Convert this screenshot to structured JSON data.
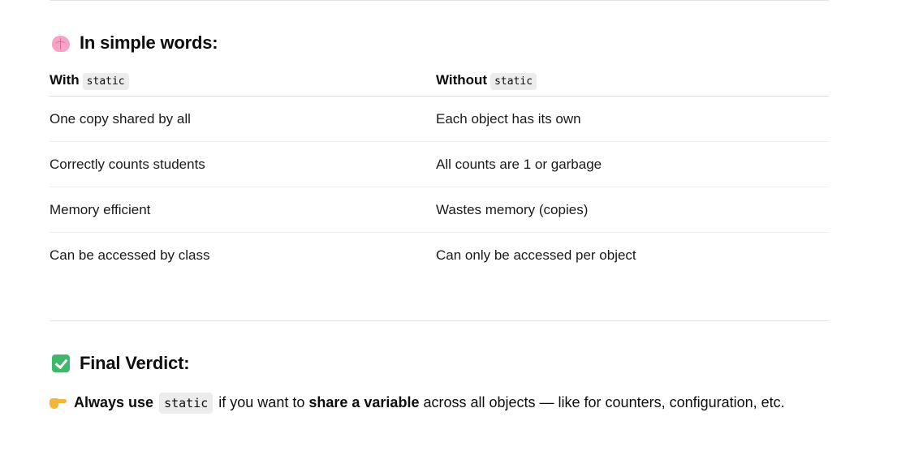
{
  "section_simple": {
    "icon": "brain-icon",
    "title": "In simple words:"
  },
  "table": {
    "headers": [
      {
        "prefix": "With",
        "code": "static"
      },
      {
        "prefix": "Without",
        "code": "static"
      }
    ],
    "rows": [
      [
        "One copy shared by all",
        "Each object has its own"
      ],
      [
        "Correctly counts students",
        "All counts are 1 or garbage"
      ],
      [
        "Memory efficient",
        "Wastes memory (copies)"
      ],
      [
        "Can be accessed by class",
        "Can only be accessed per object"
      ]
    ]
  },
  "section_verdict": {
    "icon": "check-mark-button-icon",
    "title": "Final Verdict:",
    "hand_icon": "pointing-right-hand-icon",
    "strong1": "Always use",
    "code": "static",
    "text1": "if you want to",
    "strong2": "share a variable",
    "text2": "across all objects — like for counters, configuration, etc."
  },
  "colors": {
    "code_bg": "#ececec",
    "divider": "#e3e3e3",
    "check_green": "#3fb86c",
    "brain_pink": "#f5a3c7"
  }
}
